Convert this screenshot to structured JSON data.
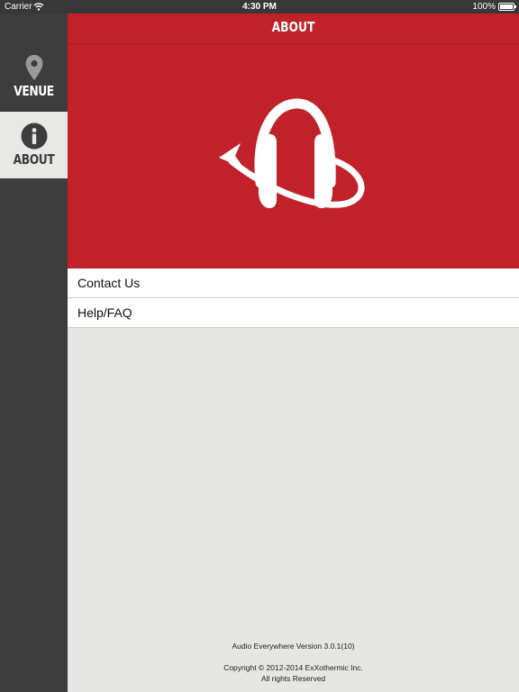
{
  "status_bar": {
    "carrier": "Carrier",
    "time": "4:30 PM",
    "battery": "100%",
    "battery_level": 1.0
  },
  "sidebar": {
    "items": [
      {
        "label": "VENUE",
        "icon": "map-pin-icon",
        "selected": false
      },
      {
        "label": "ABOUT",
        "icon": "info-icon",
        "selected": true
      }
    ]
  },
  "header": {
    "title": "ABOUT"
  },
  "banner": {
    "icon": "headphones-logo-icon"
  },
  "list": {
    "items": [
      {
        "label": "Contact Us"
      },
      {
        "label": "Help/FAQ"
      }
    ]
  },
  "footer": {
    "version": "Audio Everywhere Version 3.0.1(10)",
    "copyright": "Copyright © 2012-2014 ExXothermic Inc.",
    "rights": "All rights Reserved"
  },
  "colors": {
    "brand_red": "#c12229",
    "sidebar_dark": "#3d3d3d",
    "background": "#e6e6e4"
  }
}
